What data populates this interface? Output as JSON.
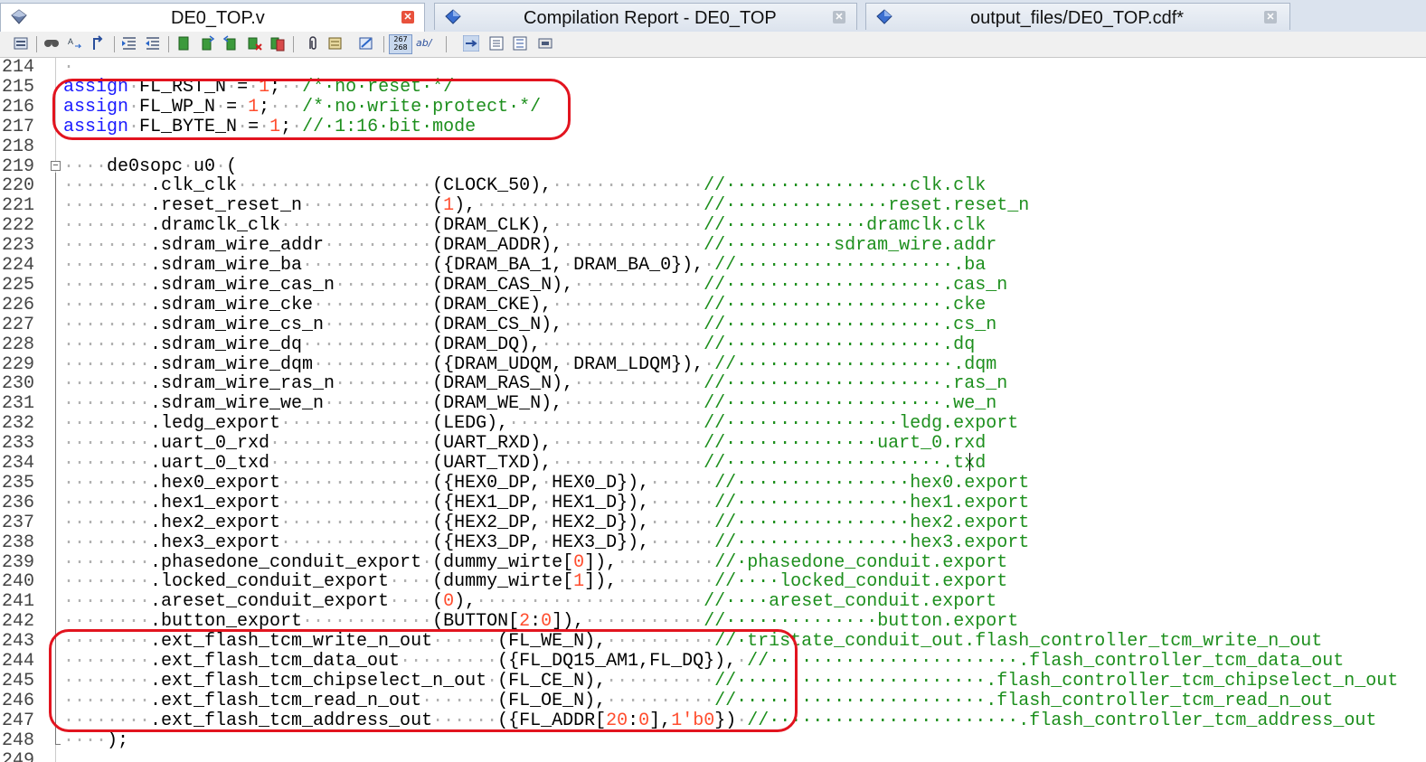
{
  "tabs": [
    {
      "label": "DE0_TOP.v",
      "icon": "verilog-file-icon",
      "active": true
    },
    {
      "label": "Compilation Report - DE0_TOP",
      "icon": "compilation-report-icon",
      "active": false
    },
    {
      "label": "output_files/DE0_TOP.cdf*",
      "icon": "chain-description-file-icon",
      "active": false
    }
  ],
  "toolbar": {
    "icons": [
      "open-file-icon",
      "find-icon",
      "find-replace-icon",
      "goto-line-icon",
      "increase-indent-icon",
      "decrease-indent-icon",
      "toggle-bookmark-icon",
      "previous-bookmark-icon",
      "next-bookmark-icon",
      "clear-bookmarks-icon",
      "bookmark-list-icon",
      "insert-template-icon",
      "comment-icon",
      "uncomment-icon",
      "line-numbers-icon",
      "word-wrap-icon",
      "enable-syntax-icon",
      "goto-block-icon",
      "expand-all-icon",
      "collapse-all-icon",
      "print-icon"
    ],
    "line_numbers_icon_text": "267\n268",
    "word_wrap_icon_text": "ab/"
  },
  "editor": {
    "lines": [
      {
        "n": "214",
        "seg": [
          [
            "ws",
            "·"
          ]
        ]
      },
      {
        "n": "215",
        "seg": [
          [
            "kw",
            "assign"
          ],
          [
            "ws",
            "·"
          ],
          [
            "t",
            "FL_RST_N"
          ],
          [
            "ws",
            "·"
          ],
          [
            "t",
            "="
          ],
          [
            "ws",
            "·"
          ],
          [
            "num",
            "1"
          ],
          [
            "t",
            ";"
          ],
          [
            "ws",
            "··"
          ],
          [
            "cm",
            "/*·no·reset·*/"
          ]
        ]
      },
      {
        "n": "216",
        "seg": [
          [
            "kw",
            "assign"
          ],
          [
            "ws",
            "·"
          ],
          [
            "t",
            "FL_WP_N"
          ],
          [
            "ws",
            "·"
          ],
          [
            "t",
            "="
          ],
          [
            "ws",
            "·"
          ],
          [
            "num",
            "1"
          ],
          [
            "t",
            ";"
          ],
          [
            "ws",
            "···"
          ],
          [
            "cm",
            "/*·no·write·protect·*/"
          ]
        ]
      },
      {
        "n": "217",
        "seg": [
          [
            "kw",
            "assign"
          ],
          [
            "ws",
            "·"
          ],
          [
            "t",
            "FL_BYTE_N"
          ],
          [
            "ws",
            "·"
          ],
          [
            "t",
            "="
          ],
          [
            "ws",
            "·"
          ],
          [
            "num",
            "1"
          ],
          [
            "t",
            ";"
          ],
          [
            "ws",
            "·"
          ],
          [
            "cm",
            "//·1:16·bit·mode"
          ]
        ]
      },
      {
        "n": "218",
        "seg": []
      },
      {
        "n": "219",
        "seg": [
          [
            "ws",
            "····"
          ],
          [
            "t",
            "de0sopc"
          ],
          [
            "ws",
            "·"
          ],
          [
            "t",
            "u0"
          ],
          [
            "ws",
            "·"
          ],
          [
            "t",
            "("
          ]
        ]
      },
      {
        "n": "220",
        "seg": [
          [
            "ws",
            "········"
          ],
          [
            "t",
            ".clk_clk"
          ],
          [
            "ws",
            "··················"
          ],
          [
            "t",
            "(CLOCK_50),"
          ],
          [
            "ws",
            "··············"
          ],
          [
            "cm",
            "//·················clk.clk"
          ]
        ]
      },
      {
        "n": "221",
        "seg": [
          [
            "ws",
            "········"
          ],
          [
            "t",
            ".reset_reset_n"
          ],
          [
            "ws",
            "············"
          ],
          [
            "t",
            "("
          ],
          [
            "num",
            "1"
          ],
          [
            "t",
            "),"
          ],
          [
            "ws",
            "·····················"
          ],
          [
            "cm",
            "//···············reset.reset_n"
          ]
        ]
      },
      {
        "n": "222",
        "seg": [
          [
            "ws",
            "········"
          ],
          [
            "t",
            ".dramclk_clk"
          ],
          [
            "ws",
            "··············"
          ],
          [
            "t",
            "(DRAM_CLK),"
          ],
          [
            "ws",
            "··············"
          ],
          [
            "cm",
            "//·············dramclk.clk"
          ]
        ]
      },
      {
        "n": "223",
        "seg": [
          [
            "ws",
            "········"
          ],
          [
            "t",
            ".sdram_wire_addr"
          ],
          [
            "ws",
            "··········"
          ],
          [
            "t",
            "(DRAM_ADDR),"
          ],
          [
            "ws",
            "·············"
          ],
          [
            "cm",
            "//··········sdram_wire.addr"
          ]
        ]
      },
      {
        "n": "224",
        "seg": [
          [
            "ws",
            "········"
          ],
          [
            "t",
            ".sdram_wire_ba"
          ],
          [
            "ws",
            "············"
          ],
          [
            "t",
            "({DRAM_BA_1,"
          ],
          [
            "ws",
            "·"
          ],
          [
            "t",
            "DRAM_BA_0}),"
          ],
          [
            "ws",
            "·"
          ],
          [
            "cm",
            "//····················.ba"
          ]
        ]
      },
      {
        "n": "225",
        "seg": [
          [
            "ws",
            "········"
          ],
          [
            "t",
            ".sdram_wire_cas_n"
          ],
          [
            "ws",
            "·········"
          ],
          [
            "t",
            "(DRAM_CAS_N),"
          ],
          [
            "ws",
            "············"
          ],
          [
            "cm",
            "//····················.cas_n"
          ]
        ]
      },
      {
        "n": "226",
        "seg": [
          [
            "ws",
            "········"
          ],
          [
            "t",
            ".sdram_wire_cke"
          ],
          [
            "ws",
            "···········"
          ],
          [
            "t",
            "(DRAM_CKE),"
          ],
          [
            "ws",
            "··············"
          ],
          [
            "cm",
            "//····················.cke"
          ]
        ]
      },
      {
        "n": "227",
        "seg": [
          [
            "ws",
            "········"
          ],
          [
            "t",
            ".sdram_wire_cs_n"
          ],
          [
            "ws",
            "··········"
          ],
          [
            "t",
            "(DRAM_CS_N),"
          ],
          [
            "ws",
            "·············"
          ],
          [
            "cm",
            "//····················.cs_n"
          ]
        ]
      },
      {
        "n": "228",
        "seg": [
          [
            "ws",
            "········"
          ],
          [
            "t",
            ".sdram_wire_dq"
          ],
          [
            "ws",
            "············"
          ],
          [
            "t",
            "(DRAM_DQ),"
          ],
          [
            "ws",
            "···············"
          ],
          [
            "cm",
            "//····················.dq"
          ]
        ]
      },
      {
        "n": "229",
        "seg": [
          [
            "ws",
            "········"
          ],
          [
            "t",
            ".sdram_wire_dqm"
          ],
          [
            "ws",
            "···········"
          ],
          [
            "t",
            "({DRAM_UDQM,"
          ],
          [
            "ws",
            "·"
          ],
          [
            "t",
            "DRAM_LDQM}),"
          ],
          [
            "ws",
            "·"
          ],
          [
            "cm",
            "//····················.dqm"
          ]
        ]
      },
      {
        "n": "230",
        "seg": [
          [
            "ws",
            "········"
          ],
          [
            "t",
            ".sdram_wire_ras_n"
          ],
          [
            "ws",
            "·········"
          ],
          [
            "t",
            "(DRAM_RAS_N),"
          ],
          [
            "ws",
            "············"
          ],
          [
            "cm",
            "//····················.ras_n"
          ]
        ]
      },
      {
        "n": "231",
        "seg": [
          [
            "ws",
            "········"
          ],
          [
            "t",
            ".sdram_wire_we_n"
          ],
          [
            "ws",
            "··········"
          ],
          [
            "t",
            "(DRAM_WE_N),"
          ],
          [
            "ws",
            "·············"
          ],
          [
            "cm",
            "//····················.we_n"
          ]
        ]
      },
      {
        "n": "232",
        "seg": [
          [
            "ws",
            "········"
          ],
          [
            "t",
            ".ledg_export"
          ],
          [
            "ws",
            "··············"
          ],
          [
            "t",
            "(LEDG),"
          ],
          [
            "ws",
            "··················"
          ],
          [
            "cm",
            "//················ledg.export"
          ]
        ]
      },
      {
        "n": "233",
        "seg": [
          [
            "ws",
            "········"
          ],
          [
            "t",
            ".uart_0_rxd"
          ],
          [
            "ws",
            "···············"
          ],
          [
            "t",
            "(UART_RXD),"
          ],
          [
            "ws",
            "··············"
          ],
          [
            "cm",
            "//··············uart_0.rxd"
          ]
        ]
      },
      {
        "n": "234",
        "seg": [
          [
            "ws",
            "········"
          ],
          [
            "t",
            ".uart_0_txd"
          ],
          [
            "ws",
            "···············"
          ],
          [
            "t",
            "(UART_TXD),"
          ],
          [
            "ws",
            "··············"
          ],
          [
            "cm",
            "//····················.txd"
          ]
        ]
      },
      {
        "n": "235",
        "seg": [
          [
            "ws",
            "········"
          ],
          [
            "t",
            ".hex0_export"
          ],
          [
            "ws",
            "··············"
          ],
          [
            "t",
            "({HEX0_DP,"
          ],
          [
            "ws",
            "·"
          ],
          [
            "t",
            "HEX0_D}),"
          ],
          [
            "ws",
            "······"
          ],
          [
            "cm",
            "//················hex0.export"
          ]
        ]
      },
      {
        "n": "236",
        "seg": [
          [
            "ws",
            "········"
          ],
          [
            "t",
            ".hex1_export"
          ],
          [
            "ws",
            "··············"
          ],
          [
            "t",
            "({HEX1_DP,"
          ],
          [
            "ws",
            "·"
          ],
          [
            "t",
            "HEX1_D}),"
          ],
          [
            "ws",
            "······"
          ],
          [
            "cm",
            "//················hex1.export"
          ]
        ]
      },
      {
        "n": "237",
        "seg": [
          [
            "ws",
            "········"
          ],
          [
            "t",
            ".hex2_export"
          ],
          [
            "ws",
            "··············"
          ],
          [
            "t",
            "({HEX2_DP,"
          ],
          [
            "ws",
            "·"
          ],
          [
            "t",
            "HEX2_D}),"
          ],
          [
            "ws",
            "······"
          ],
          [
            "cm",
            "//················hex2.export"
          ]
        ]
      },
      {
        "n": "238",
        "seg": [
          [
            "ws",
            "········"
          ],
          [
            "t",
            ".hex3_export"
          ],
          [
            "ws",
            "··············"
          ],
          [
            "t",
            "({HEX3_DP,"
          ],
          [
            "ws",
            "·"
          ],
          [
            "t",
            "HEX3_D}),"
          ],
          [
            "ws",
            "······"
          ],
          [
            "cm",
            "//················hex3.export"
          ]
        ]
      },
      {
        "n": "239",
        "seg": [
          [
            "ws",
            "········"
          ],
          [
            "t",
            ".phasedone_conduit_export"
          ],
          [
            "ws",
            "·"
          ],
          [
            "t",
            "(dummy_wirte["
          ],
          [
            "num",
            "0"
          ],
          [
            "t",
            "]),"
          ],
          [
            "ws",
            "·········"
          ],
          [
            "cm",
            "//·phasedone_conduit.export"
          ]
        ]
      },
      {
        "n": "240",
        "seg": [
          [
            "ws",
            "········"
          ],
          [
            "t",
            ".locked_conduit_export"
          ],
          [
            "ws",
            "····"
          ],
          [
            "t",
            "(dummy_wirte["
          ],
          [
            "num",
            "1"
          ],
          [
            "t",
            "]),"
          ],
          [
            "ws",
            "·········"
          ],
          [
            "cm",
            "//····locked_conduit.export"
          ]
        ]
      },
      {
        "n": "241",
        "seg": [
          [
            "ws",
            "········"
          ],
          [
            "t",
            ".areset_conduit_export"
          ],
          [
            "ws",
            "····"
          ],
          [
            "t",
            "("
          ],
          [
            "num",
            "0"
          ],
          [
            "t",
            "),"
          ],
          [
            "ws",
            "·····················"
          ],
          [
            "cm",
            "//····areset_conduit.export"
          ]
        ]
      },
      {
        "n": "242",
        "seg": [
          [
            "ws",
            "········"
          ],
          [
            "t",
            ".button_export"
          ],
          [
            "ws",
            "············"
          ],
          [
            "t",
            "(BUTTON["
          ],
          [
            "num",
            "2"
          ],
          [
            "t",
            ":"
          ],
          [
            "num",
            "0"
          ],
          [
            "t",
            "]),"
          ],
          [
            "ws",
            "···········"
          ],
          [
            "cm",
            "//··············button.export"
          ]
        ]
      },
      {
        "n": "243",
        "seg": [
          [
            "ws",
            "········"
          ],
          [
            "t",
            ".ext_flash_tcm_write_n_out"
          ],
          [
            "ws",
            "······"
          ],
          [
            "t",
            "(FL_WE_N),"
          ],
          [
            "ws",
            "··········"
          ],
          [
            "cm",
            "//·tristate_conduit_out.flash_controller_tcm_write_n_out"
          ]
        ]
      },
      {
        "n": "244",
        "seg": [
          [
            "ws",
            "········"
          ],
          [
            "t",
            ".ext_flash_tcm_data_out"
          ],
          [
            "ws",
            "·········"
          ],
          [
            "t",
            "({FL_DQ15_AM1,FL_DQ}),"
          ],
          [
            "ws",
            "·"
          ],
          [
            "cm",
            "//·······················.flash_controller_tcm_data_out"
          ]
        ]
      },
      {
        "n": "245",
        "seg": [
          [
            "ws",
            "········"
          ],
          [
            "t",
            ".ext_flash_tcm_chipselect_n_out"
          ],
          [
            "ws",
            "·"
          ],
          [
            "t",
            "(FL_CE_N),"
          ],
          [
            "ws",
            "··········"
          ],
          [
            "cm",
            "//·······················.flash_controller_tcm_chipselect_n_out"
          ]
        ]
      },
      {
        "n": "246",
        "seg": [
          [
            "ws",
            "········"
          ],
          [
            "t",
            ".ext_flash_tcm_read_n_out"
          ],
          [
            "ws",
            "·······"
          ],
          [
            "t",
            "(FL_OE_N),"
          ],
          [
            "ws",
            "··········"
          ],
          [
            "cm",
            "//·······················.flash_controller_tcm_read_n_out"
          ]
        ]
      },
      {
        "n": "247",
        "seg": [
          [
            "ws",
            "········"
          ],
          [
            "t",
            ".ext_flash_tcm_address_out"
          ],
          [
            "ws",
            "······"
          ],
          [
            "t",
            "({FL_ADDR["
          ],
          [
            "num",
            "20"
          ],
          [
            "t",
            ":"
          ],
          [
            "num",
            "0"
          ],
          [
            "t",
            "],"
          ],
          [
            "num",
            "1'b0"
          ],
          [
            "t",
            "})"
          ],
          [
            "ws",
            "·"
          ],
          [
            "cm",
            "//·······················.flash_controller_tcm_address_out"
          ]
        ]
      },
      {
        "n": "248",
        "seg": [
          [
            "ws",
            "····"
          ],
          [
            "t",
            ");"
          ]
        ]
      },
      {
        "n": "249",
        "seg": []
      }
    ]
  },
  "colors": {
    "keyword": "#1a1aff",
    "number": "#ff4d2e",
    "comment": "#1d8f1d",
    "annotation": "#e2141f"
  }
}
